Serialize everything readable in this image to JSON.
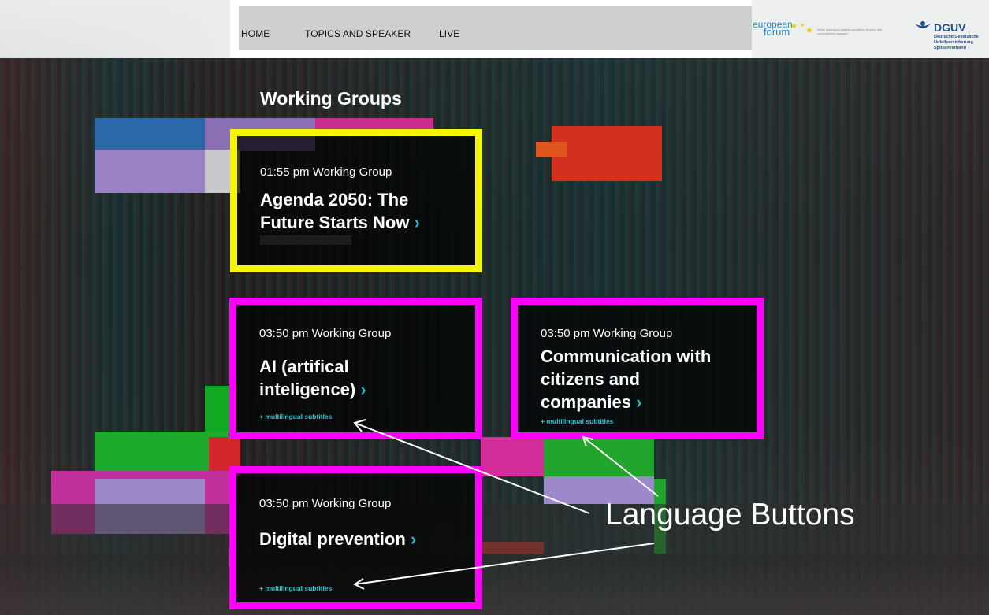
{
  "nav": {
    "items": [
      {
        "label": "HOME"
      },
      {
        "label": "TOPICS AND SPEAKER"
      },
      {
        "label": "LIVE"
      }
    ]
  },
  "logos": {
    "european_forum": {
      "line1": "european",
      "line2": "forum",
      "small_text": "of the insurance against accidents at work and occupational diseases"
    },
    "dguv": {
      "title": "DGUV",
      "subtitle": "Deutsche Gesetzliche Unfallversicherung Spitzenverband"
    }
  },
  "section": {
    "title": "Working Groups"
  },
  "cards": [
    {
      "time": "01:55 pm Working Group",
      "title_line1": "Agenda 2050: The",
      "title_line2": "Future Starts Now",
      "chevron": "›",
      "subtitles": "",
      "border_color": "#f5f500"
    },
    {
      "time": "03:50 pm Working Group",
      "title_line1": "AI (artifical",
      "title_line2": "inteligence)",
      "chevron": "›",
      "subtitles": "+ multilingual subtitles",
      "border_color": "#ff00ff"
    },
    {
      "time": "03:50 pm Working Group",
      "title_line1": "Communication with",
      "title_line2": "citizens and",
      "title_line3": "companies",
      "chevron": "›",
      "subtitles": "+ multilingual subtitles",
      "border_color": "#ff00ff"
    },
    {
      "time": "03:50 pm Working Group",
      "title_line1": "Digital prevention",
      "chevron": "›",
      "subtitles": "+ multilingual subtitles",
      "border_color": "#ff00ff"
    }
  ],
  "annotation": {
    "label": "Language Buttons",
    "color": "#ffffff"
  },
  "colors": {
    "chevron": "#19b8c9",
    "subtitle_link": "#24c8d6",
    "highlight_yellow": "#f5f500",
    "highlight_magenta": "#ff00ff"
  }
}
